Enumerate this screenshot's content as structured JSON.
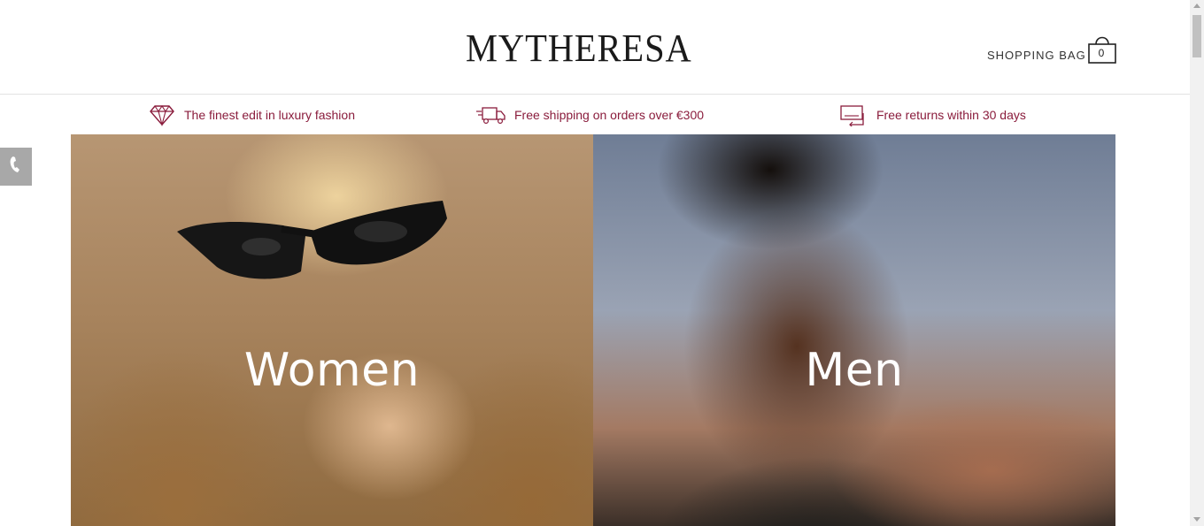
{
  "header": {
    "logo_text": "MYTHERESA",
    "shopping_bag_label": "SHOPPING BAG",
    "bag_count": "0"
  },
  "usp": [
    {
      "icon": "diamond-icon",
      "text": "The finest edit in luxury fashion"
    },
    {
      "icon": "truck-icon",
      "text": "Free shipping on orders over €300"
    },
    {
      "icon": "returns-icon",
      "text": "Free returns within 30 days"
    }
  ],
  "hero": {
    "women_label": "Women",
    "men_label": "Men"
  },
  "side": {
    "icon": "phone-icon"
  },
  "colors": {
    "usp_text": "#8a1c3c",
    "logo": "#1a1a1a",
    "phone_tab": "#a8a8a8"
  }
}
